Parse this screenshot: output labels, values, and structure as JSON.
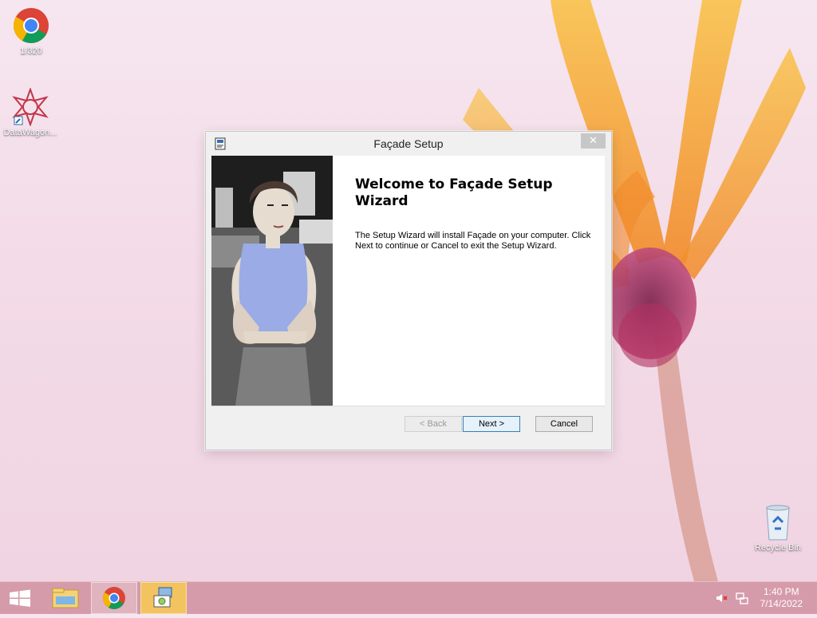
{
  "desktop": {
    "icons": [
      {
        "label": "1/320"
      },
      {
        "label": "DataWagon..."
      },
      {
        "label": "Recycle Bin"
      }
    ]
  },
  "dialog": {
    "title": "Façade Setup",
    "close_glyph": "✕",
    "heading": "Welcome to Façade Setup Wizard",
    "description": "The Setup Wizard will install Façade on your computer.  Click Next to continue or Cancel to exit the Setup Wizard.",
    "buttons": {
      "back": "< Back",
      "next": "Next >",
      "cancel": "Cancel"
    }
  },
  "taskbar": {
    "time": "1:40 PM",
    "date": "7/14/2022"
  },
  "colors": {
    "taskbar": "#d396a5",
    "dialog_bg": "#f0f0f0",
    "default_button_border": "#3c7fb1"
  }
}
